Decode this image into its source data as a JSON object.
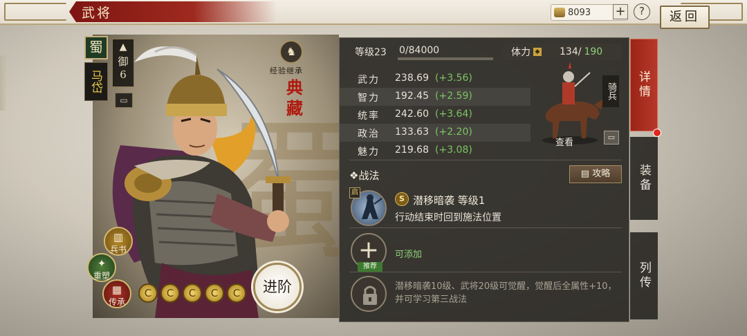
{
  "header": {
    "title": "武将",
    "currency_value": "8093",
    "add_label": "+",
    "help_label": "?",
    "back_label": "返回"
  },
  "hero": {
    "faction": "蜀",
    "name": "马岱",
    "unit_type_label": "御",
    "unit_type_value": "6",
    "inherit_label": "经验继承",
    "collection_label": "典藏",
    "buttons": {
      "book": "兵书",
      "remold": "重塑",
      "inherit": "传承"
    },
    "star_glyph": "C",
    "stars_count": 5,
    "advance_label": "进阶"
  },
  "stats": {
    "level_label": "等级23",
    "exp_text": "0/84000",
    "exp_fraction": 0.0,
    "stamina_label": "体力",
    "stamina_value": "134/",
    "stamina_max": "190",
    "rows": [
      {
        "name": "武力",
        "value": "238.69",
        "bonus": "(+3.56)"
      },
      {
        "name": "智力",
        "value": "192.45",
        "bonus": "(+2.59)"
      },
      {
        "name": "统率",
        "value": "242.60",
        "bonus": "(+3.64)"
      },
      {
        "name": "政治",
        "value": "133.63",
        "bonus": "(+2.20)"
      },
      {
        "name": "魅力",
        "value": "219.68",
        "bonus": "(+3.08)"
      }
    ],
    "unit_class": "骑兵",
    "view_label": "查看"
  },
  "tactics": {
    "section_title": "❖战法",
    "guide_label": "攻略",
    "start_tag": "启",
    "grade": "S",
    "skill_name": "潜移暗袭  等级1",
    "skill_desc": "行动结束时回到施法位置",
    "add_symbol": "+",
    "addable_label": "可添加",
    "recommend_label": "推荐",
    "locked_desc": "潜移暗袭10级、武将20级可觉醒，觉醒后全属性+10，并可学习第三战法"
  },
  "side_tabs": {
    "detail": "详情",
    "equip": "装备",
    "bio": "列传"
  },
  "colors": {
    "accent_red": "#b6392a",
    "bonus_green": "#7cc564",
    "gold": "#d8b24a"
  }
}
